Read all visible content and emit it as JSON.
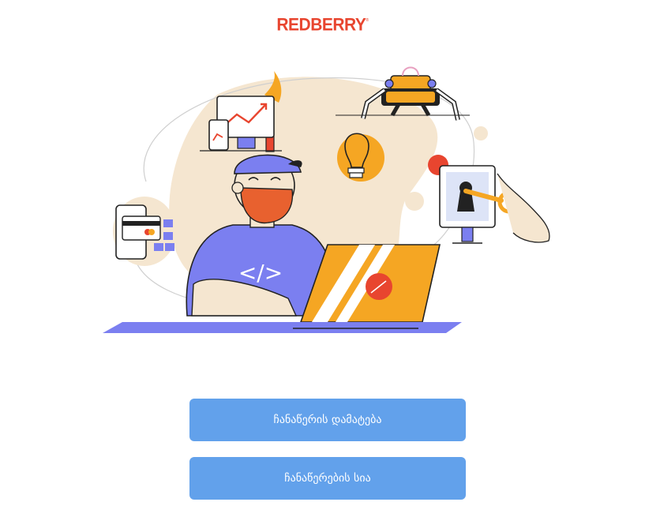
{
  "brand": {
    "logo_text": "REDBERRY",
    "trademark": "®",
    "color": "#e8452f"
  },
  "actions": {
    "add_entry_label": "ჩანაწერის დამატება",
    "entries_list_label": "ჩანაწერების სია",
    "button_color": "#62a1eb"
  },
  "illustration": {
    "code_symbol": "</>"
  }
}
